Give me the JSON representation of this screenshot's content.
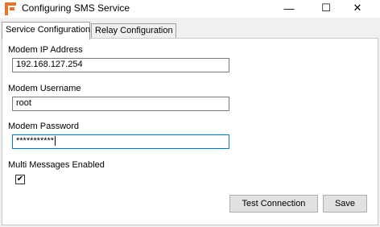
{
  "window": {
    "title": "Configuring SMS Service",
    "minimize_glyph": "—",
    "maximize_glyph": "☐",
    "close_glyph": "✕",
    "app_icon": "sms-service-icon"
  },
  "tabs": [
    {
      "label": "Service Configuration",
      "active": true
    },
    {
      "label": "Relay Configuration",
      "active": false
    }
  ],
  "form": {
    "ip_label": "Modem IP Address",
    "ip_value": "192.168.127.254",
    "username_label": "Modem Username",
    "username_value": "root",
    "password_label": "Modem Password",
    "password_value": "***********",
    "multi_label": "Multi Messages Enabled",
    "multi_checked": true,
    "check_glyph": "✔"
  },
  "buttons": {
    "test_label": "Test Connection",
    "save_label": "Save"
  },
  "colors": {
    "accent": "#0078d7",
    "icon": "#e8732a"
  }
}
